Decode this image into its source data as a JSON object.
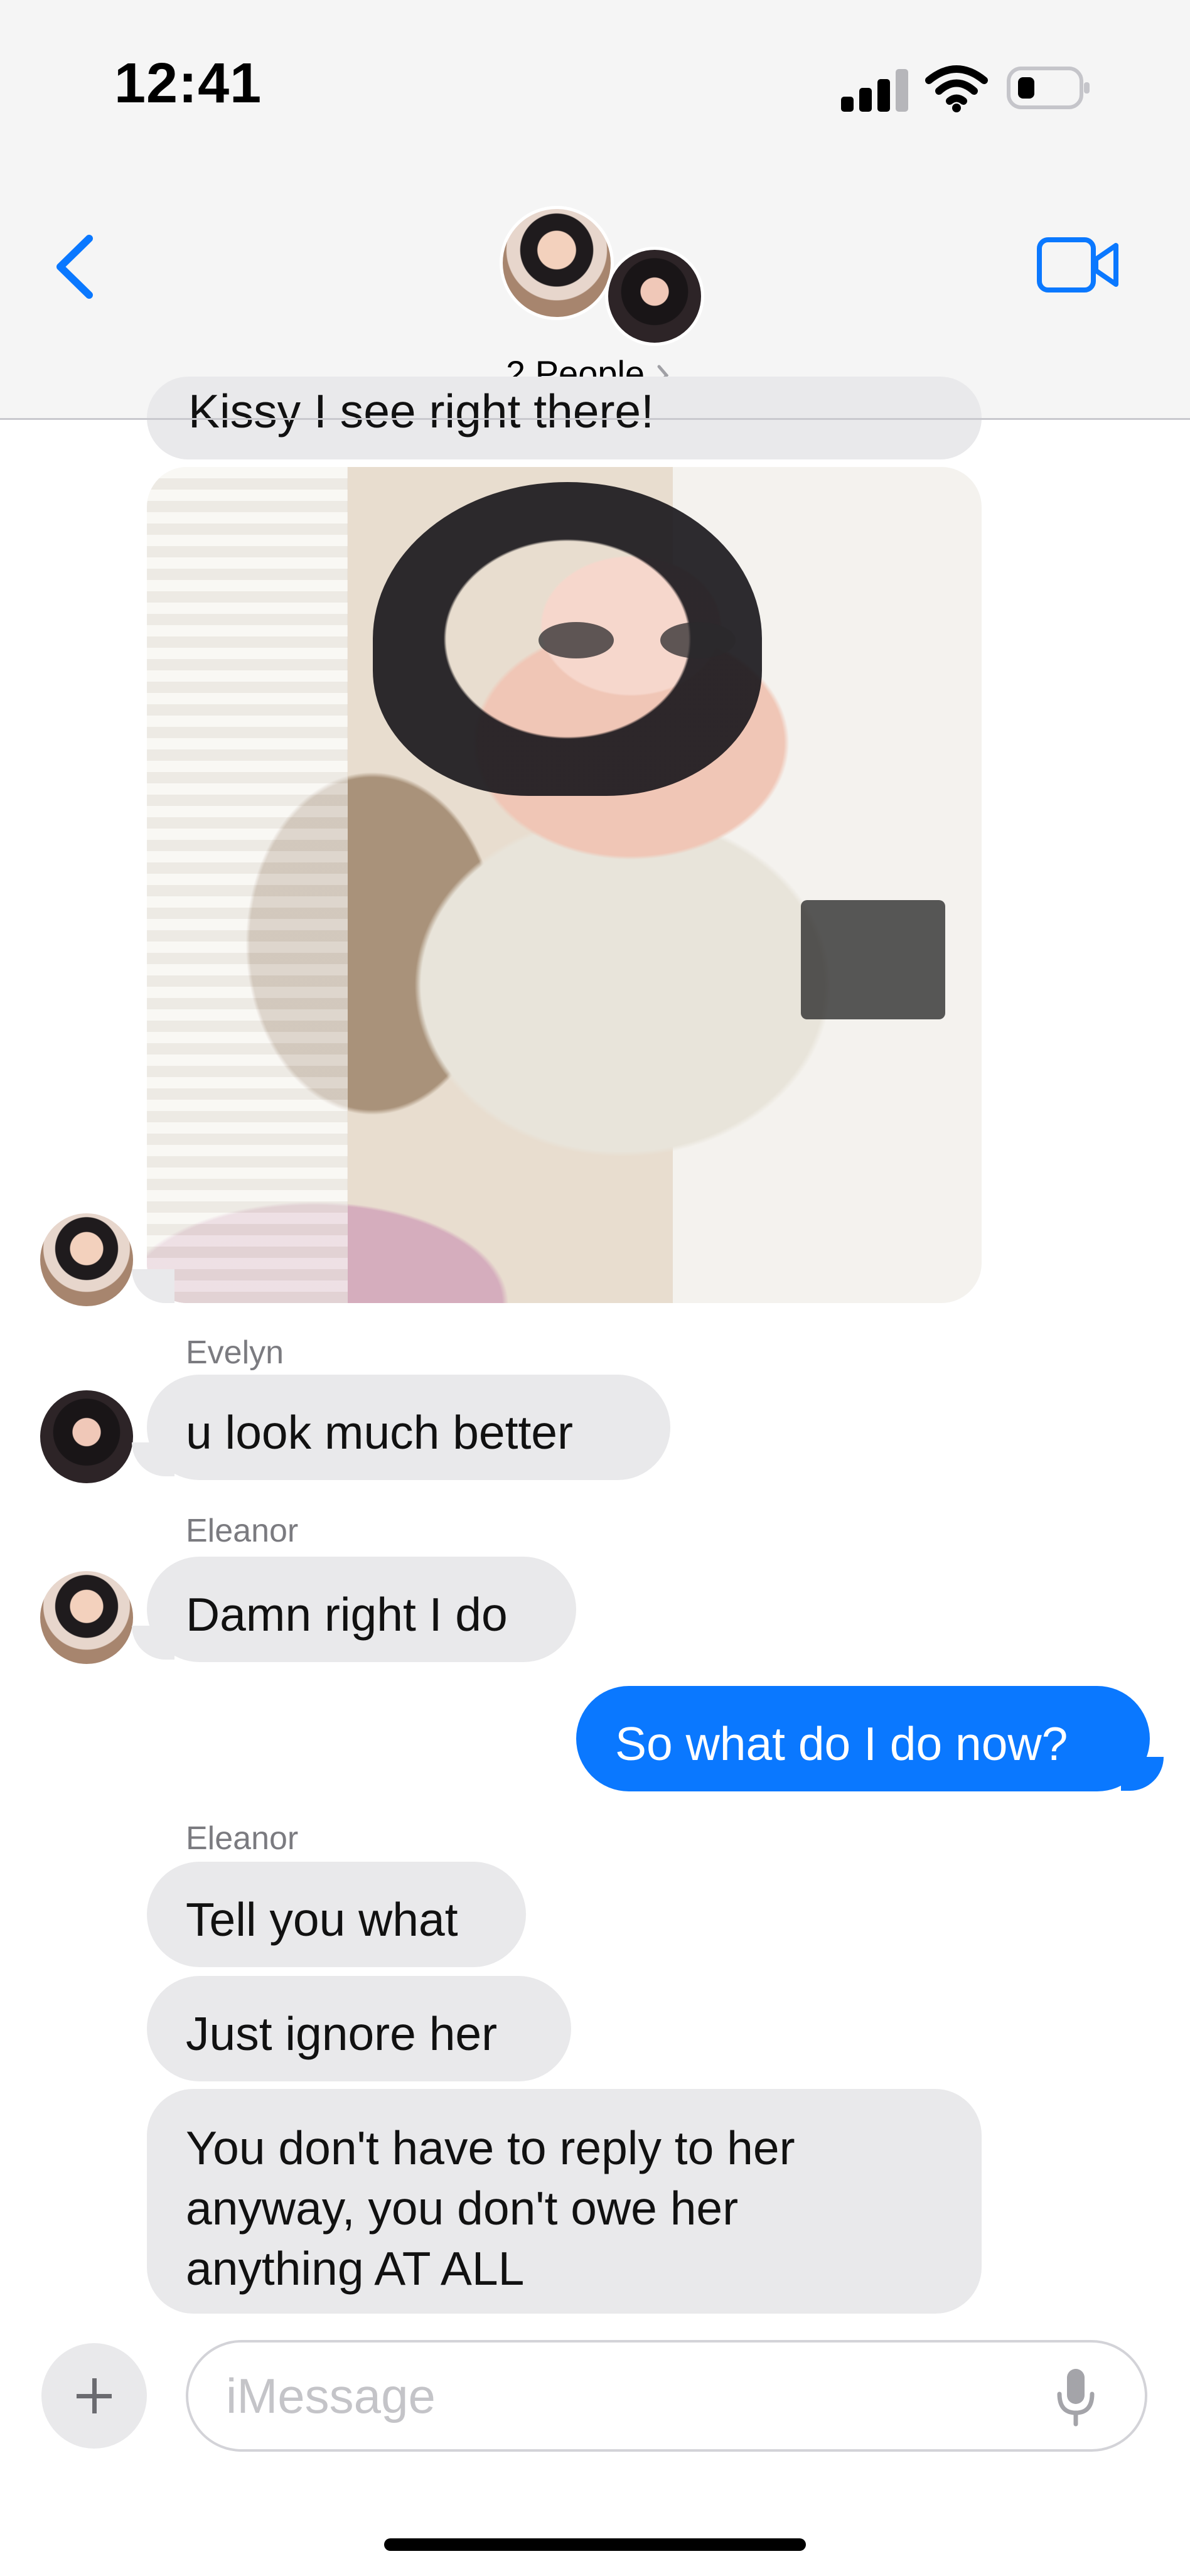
{
  "status": {
    "time": "12:41"
  },
  "header": {
    "people": "2 People",
    "icons": {
      "back": "chevron-left-icon",
      "video": "video-camera-icon",
      "people_chevron": "chevron-right-icon"
    }
  },
  "thread": {
    "partial_message": "Kissy I see right there!",
    "messages": [
      {
        "sender": "Evelyn",
        "text": "u look much better"
      },
      {
        "sender": "Eleanor",
        "text": "Damn right I do"
      },
      {
        "text": "So what do I do now?"
      },
      {
        "sender": "Eleanor",
        "texts": [
          "Tell you what",
          "Just ignore her"
        ],
        "long_text": [
          "You don't have to reply to her",
          "anyway, you don't owe her",
          "anything AT ALL"
        ]
      }
    ]
  },
  "composer": {
    "placeholder": "iMessage",
    "icons": {
      "plus": "plus-icon",
      "mic": "microphone-icon"
    }
  }
}
